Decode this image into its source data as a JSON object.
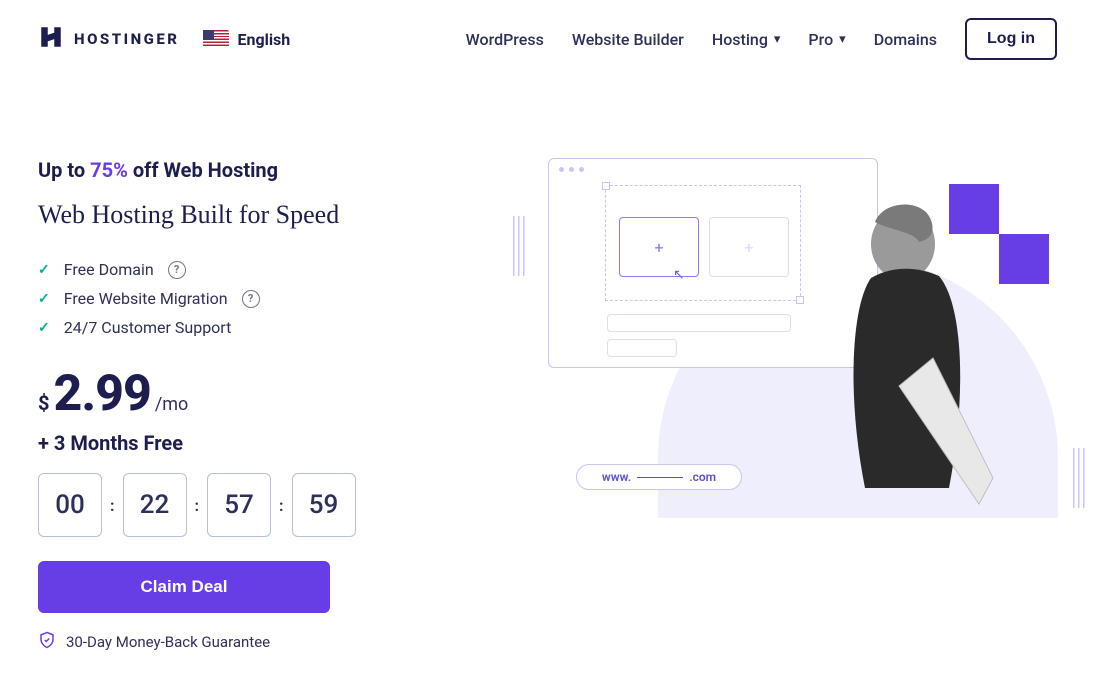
{
  "brand": "HOSTINGER",
  "language": "English",
  "nav": {
    "wordpress": "WordPress",
    "builder": "Website Builder",
    "hosting": "Hosting",
    "pro": "Pro",
    "domains": "Domains",
    "login": "Log in"
  },
  "hero": {
    "promo_prefix": "Up to ",
    "promo_pct": "75%",
    "promo_suffix": " off Web Hosting",
    "headline": "Web Hosting Built for Speed",
    "features": {
      "domain": "Free Domain",
      "migration": "Free Website Migration",
      "support": "24/7 Customer Support"
    },
    "currency": "$",
    "price": "2.99",
    "period": "/mo",
    "bonus": "+ 3 Months Free",
    "timer": {
      "d": "00",
      "h": "22",
      "m": "57",
      "s": "59"
    },
    "cta": "Claim Deal",
    "guarantee": "30-Day Money-Back Guarantee",
    "url_www": "www.",
    "url_tld": ".com"
  }
}
